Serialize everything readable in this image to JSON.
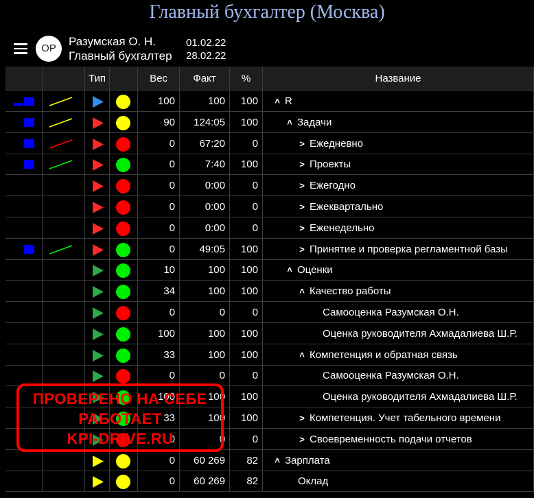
{
  "title": "Главный бухгалтер (Москва)",
  "user": {
    "initials": "ОР",
    "name": "Разумская О. Н.",
    "role": "Главный бухгалтер",
    "date_from": "01.02.22",
    "date_to": "28.02.22"
  },
  "columns": [
    "",
    "",
    "Тип",
    "",
    "Вес",
    "Факт",
    "%",
    "Название"
  ],
  "colors": {
    "blue": "#0000ff",
    "yellow": "#ffff00",
    "red": "#ff0000",
    "green": "#00ee00",
    "tri_blue": "#2f8ff0",
    "tri_red": "#ff2a2a",
    "tri_green": "#2ea84a",
    "tri_yellow": "#ffff00"
  },
  "rows": [
    {
      "bars": "double",
      "trend": "yellow",
      "tri": "tri_blue",
      "dot": "yellow",
      "weight": "100",
      "fact": "100",
      "pct": "100",
      "level": 0,
      "chevron": "up",
      "name": "R"
    },
    {
      "bars": "single",
      "trend": "yellow",
      "tri": "tri_red",
      "dot": "yellow",
      "weight": "90",
      "fact": "124:05",
      "pct": "100",
      "level": 1,
      "chevron": "up",
      "name": "Задачи"
    },
    {
      "bars": "single",
      "trend": "red",
      "tri": "tri_red",
      "dot": "red",
      "weight": "0",
      "fact": "67:20",
      "pct": "0",
      "level": 2,
      "chevron": "right",
      "name": "Ежедневно"
    },
    {
      "bars": "single",
      "trend": "green",
      "tri": "tri_red",
      "dot": "green",
      "weight": "0",
      "fact": "7:40",
      "pct": "100",
      "level": 2,
      "chevron": "right",
      "name": "Проекты"
    },
    {
      "bars": "",
      "trend": "",
      "tri": "tri_red",
      "dot": "red",
      "weight": "0",
      "fact": "0:00",
      "pct": "0",
      "level": 2,
      "chevron": "right",
      "name": "Ежегодно"
    },
    {
      "bars": "",
      "trend": "",
      "tri": "tri_red",
      "dot": "red",
      "weight": "0",
      "fact": "0:00",
      "pct": "0",
      "level": 2,
      "chevron": "right",
      "name": "Ежеквартально"
    },
    {
      "bars": "",
      "trend": "",
      "tri": "tri_red",
      "dot": "red",
      "weight": "0",
      "fact": "0:00",
      "pct": "0",
      "level": 2,
      "chevron": "right",
      "name": "Еженедельно"
    },
    {
      "bars": "single",
      "trend": "green",
      "tri": "tri_red",
      "dot": "green",
      "weight": "0",
      "fact": "49:05",
      "pct": "100",
      "level": 2,
      "chevron": "right",
      "name": "Принятие и проверка регламентной базы"
    },
    {
      "bars": "",
      "trend": "",
      "tri": "tri_green",
      "dot": "green",
      "weight": "10",
      "fact": "100",
      "pct": "100",
      "level": 1,
      "chevron": "up",
      "name": "Оценки"
    },
    {
      "bars": "",
      "trend": "",
      "tri": "tri_green",
      "dot": "green",
      "weight": "34",
      "fact": "100",
      "pct": "100",
      "level": 2,
      "chevron": "up",
      "name": "Качество работы"
    },
    {
      "bars": "",
      "trend": "",
      "tri": "tri_green",
      "dot": "red",
      "weight": "0",
      "fact": "0",
      "pct": "0",
      "level": 3,
      "chevron": "",
      "name": "Самооценка Разумская О.Н."
    },
    {
      "bars": "",
      "trend": "",
      "tri": "tri_green",
      "dot": "green",
      "weight": "100",
      "fact": "100",
      "pct": "100",
      "level": 3,
      "chevron": "",
      "name": "Оценка руководителя Ахмадалиева Ш.Р."
    },
    {
      "bars": "",
      "trend": "",
      "tri": "tri_green",
      "dot": "green",
      "weight": "33",
      "fact": "100",
      "pct": "100",
      "level": 2,
      "chevron": "up",
      "name": "Компетенция и обратная связь"
    },
    {
      "bars": "",
      "trend": "",
      "tri": "tri_green",
      "dot": "red",
      "weight": "0",
      "fact": "0",
      "pct": "0",
      "level": 3,
      "chevron": "",
      "name": "Самооценка Разумская О.Н."
    },
    {
      "bars": "",
      "trend": "",
      "tri": "tri_green",
      "dot": "green",
      "weight": "100",
      "fact": "100",
      "pct": "100",
      "level": 3,
      "chevron": "",
      "name": "Оценка руководителя Ахмадалиева Ш.Р."
    },
    {
      "bars": "",
      "trend": "",
      "tri": "tri_green",
      "dot": "green",
      "weight": "33",
      "fact": "100",
      "pct": "100",
      "level": 2,
      "chevron": "right",
      "name": "Компетенция. Учет табельного времени"
    },
    {
      "bars": "",
      "trend": "",
      "tri": "tri_green",
      "dot": "red",
      "weight": "0",
      "fact": "0",
      "pct": "0",
      "level": 2,
      "chevron": "right",
      "name": "Своевременность подачи отчетов"
    },
    {
      "bars": "",
      "trend": "",
      "tri": "tri_yellow",
      "dot": "yellow",
      "weight": "0",
      "fact": "60 269",
      "pct": "82",
      "level": 0,
      "chevron": "up",
      "name": "Зарплата"
    },
    {
      "bars": "",
      "trend": "",
      "tri": "tri_yellow",
      "dot": "yellow",
      "weight": "0",
      "fact": "60 269",
      "pct": "82",
      "level": 1,
      "chevron": "",
      "name": "Оклад"
    }
  ],
  "watermark": {
    "line1": "ПРОВЕРЕНО НА СЕБЕ",
    "line2": "РАБОТАЕТ",
    "line3": "KPI-DRIVE.RU"
  }
}
